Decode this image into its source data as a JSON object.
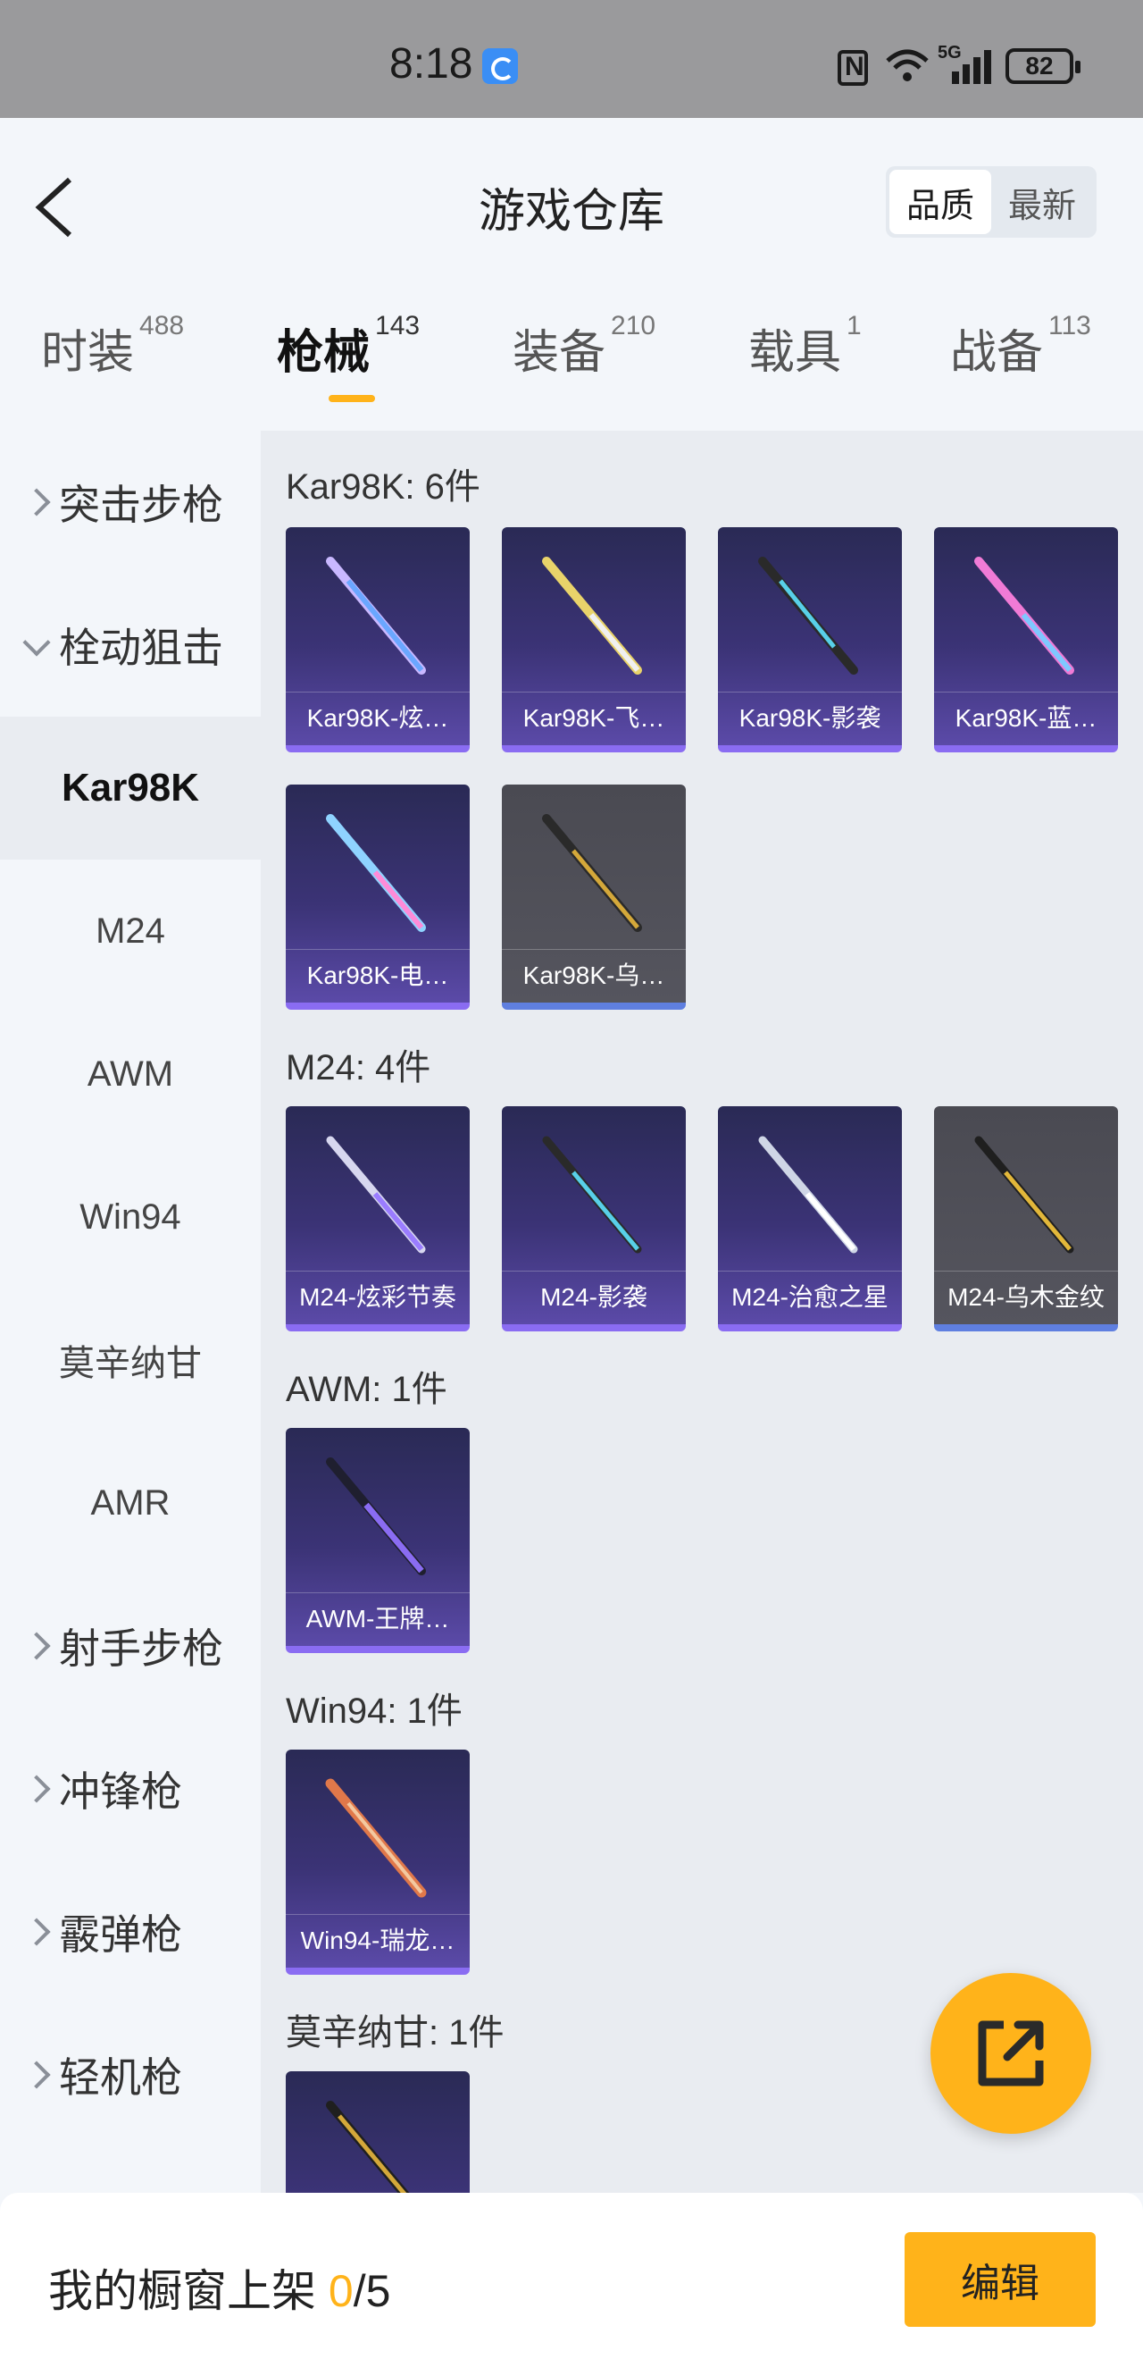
{
  "status_bar": {
    "time": "8:18",
    "network": "5G",
    "battery": "82"
  },
  "header": {
    "title": "游戏仓库",
    "sort": [
      "品质",
      "最新"
    ]
  },
  "tabs": [
    {
      "label": "时装",
      "count": "488"
    },
    {
      "label": "枪械",
      "count": "143"
    },
    {
      "label": "装备",
      "count": "210"
    },
    {
      "label": "载具",
      "count": "1"
    },
    {
      "label": "战备",
      "count": "113"
    }
  ],
  "sidebar": {
    "categories": [
      "突击步枪",
      "栓动狙击",
      "射手步枪",
      "冲锋枪",
      "霰弹枪",
      "轻机枪"
    ],
    "sub_items": [
      "Kar98K",
      "M24",
      "AWM",
      "Win94",
      "莫辛纳甘",
      "AMR"
    ]
  },
  "sections": [
    {
      "title": "Kar98K: 6件",
      "items": [
        "Kar98K-炫…",
        "Kar98K-飞…",
        "Kar98K-影袭",
        "Kar98K-蓝…",
        "Kar98K-电…",
        "Kar98K-乌…"
      ]
    },
    {
      "title": "M24: 4件",
      "items": [
        "M24-炫彩节奏",
        "M24-影袭",
        "M24-治愈之星",
        "M24-乌木金纹"
      ]
    },
    {
      "title": "AWM: 1件",
      "items": [
        "AWM-王牌…"
      ]
    },
    {
      "title": "Win94: 1件",
      "items": [
        "Win94-瑞龙…"
      ]
    },
    {
      "title": "莫辛纳甘: 1件",
      "items": []
    }
  ],
  "bottom": {
    "label": "我的橱窗上架 ",
    "current": "0",
    "total": "/5",
    "edit_label": "编辑"
  },
  "colors": {
    "accent": "#ffb31a",
    "card_purple": "#3b3376",
    "card_gray": "#4f4f57"
  },
  "icons": {
    "back": "back-arrow-icon",
    "fab": "share-external-icon"
  }
}
